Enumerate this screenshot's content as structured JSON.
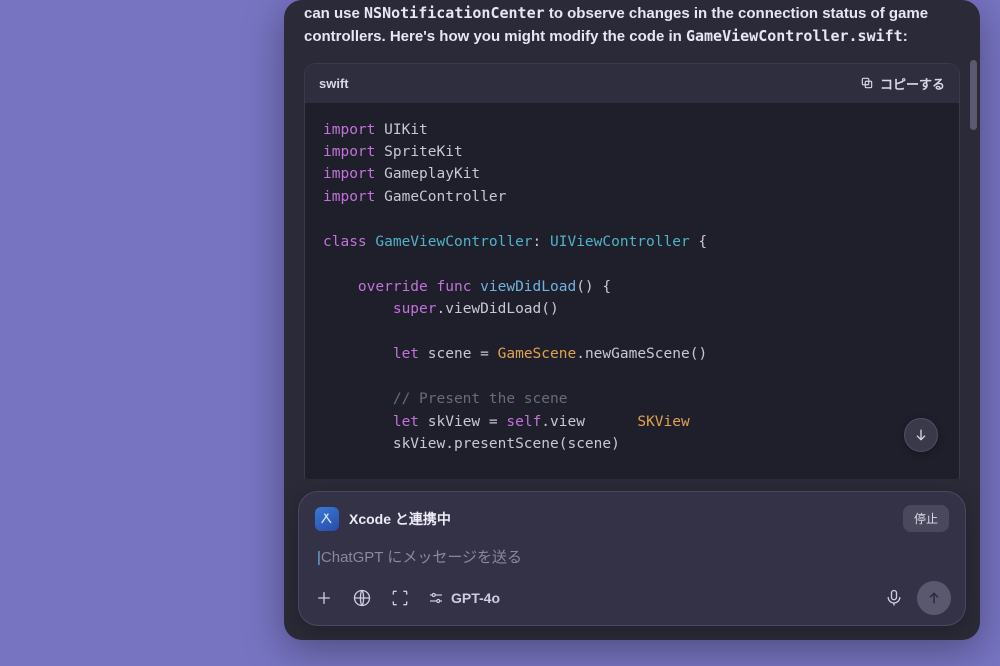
{
  "response": {
    "text_prefix": "can use ",
    "text_code1": "NSNotificationCenter",
    "text_mid": " to observe changes in the connection status of game controllers. Here's how you might modify the code in ",
    "text_code2": "GameViewController.swift",
    "text_suffix": ":"
  },
  "codeblock": {
    "language": "swift",
    "copy_label": "コピーする",
    "lines": [
      {
        "t": [
          [
            "kw",
            "import"
          ],
          [
            "sp",
            " "
          ],
          [
            "id",
            "UIKit"
          ]
        ]
      },
      {
        "t": [
          [
            "kw",
            "import"
          ],
          [
            "sp",
            " "
          ],
          [
            "id",
            "SpriteKit"
          ]
        ]
      },
      {
        "t": [
          [
            "kw",
            "import"
          ],
          [
            "sp",
            " "
          ],
          [
            "id",
            "GameplayKit"
          ]
        ]
      },
      {
        "t": [
          [
            "kw",
            "import"
          ],
          [
            "sp",
            " "
          ],
          [
            "id",
            "GameController"
          ]
        ]
      },
      {
        "t": []
      },
      {
        "t": [
          [
            "kw",
            "class"
          ],
          [
            "sp",
            " "
          ],
          [
            "type",
            "GameViewController"
          ],
          [
            "pun",
            ": "
          ],
          [
            "type",
            "UIViewController"
          ],
          [
            "sp",
            " "
          ],
          [
            "pun",
            "{"
          ]
        ]
      },
      {
        "t": []
      },
      {
        "t": [
          [
            "sp",
            "    "
          ],
          [
            "kw",
            "override"
          ],
          [
            "sp",
            " "
          ],
          [
            "kw",
            "func"
          ],
          [
            "sp",
            " "
          ],
          [
            "func",
            "viewDidLoad"
          ],
          [
            "pun",
            "() {"
          ]
        ]
      },
      {
        "t": [
          [
            "sp",
            "        "
          ],
          [
            "self",
            "super"
          ],
          [
            "pun",
            "."
          ],
          [
            "id",
            "viewDidLoad"
          ],
          [
            "pun",
            "()"
          ]
        ]
      },
      {
        "t": []
      },
      {
        "t": [
          [
            "sp",
            "        "
          ],
          [
            "kw",
            "let"
          ],
          [
            "sp",
            " "
          ],
          [
            "id",
            "scene"
          ],
          [
            "sp",
            " "
          ],
          [
            "pun",
            "="
          ],
          [
            "sp",
            " "
          ],
          [
            "cls",
            "GameScene"
          ],
          [
            "pun",
            "."
          ],
          [
            "id",
            "newGameScene"
          ],
          [
            "pun",
            "()"
          ]
        ]
      },
      {
        "t": []
      },
      {
        "t": [
          [
            "sp",
            "        "
          ],
          [
            "cmt",
            "// Present the scene"
          ]
        ]
      },
      {
        "t": [
          [
            "sp",
            "        "
          ],
          [
            "kw",
            "let"
          ],
          [
            "sp",
            " "
          ],
          [
            "id",
            "skView"
          ],
          [
            "sp",
            " "
          ],
          [
            "pun",
            "="
          ],
          [
            "sp",
            " "
          ],
          [
            "self",
            "self"
          ],
          [
            "pun",
            "."
          ],
          [
            "id",
            "view"
          ],
          [
            "sp",
            "      "
          ],
          [
            "cls",
            "SKView"
          ]
        ]
      },
      {
        "t": [
          [
            "sp",
            "        "
          ],
          [
            "id",
            "skView"
          ],
          [
            "pun",
            "."
          ],
          [
            "id",
            "presentScene"
          ],
          [
            "pun",
            "("
          ],
          [
            "id",
            "scene"
          ],
          [
            "pun",
            ")"
          ]
        ]
      }
    ]
  },
  "link_banner": {
    "label": "Xcode と連携中",
    "stop": "停止"
  },
  "input": {
    "placeholder": "ChatGPT にメッセージを送る"
  },
  "toolbar": {
    "model": "GPT-4o"
  }
}
